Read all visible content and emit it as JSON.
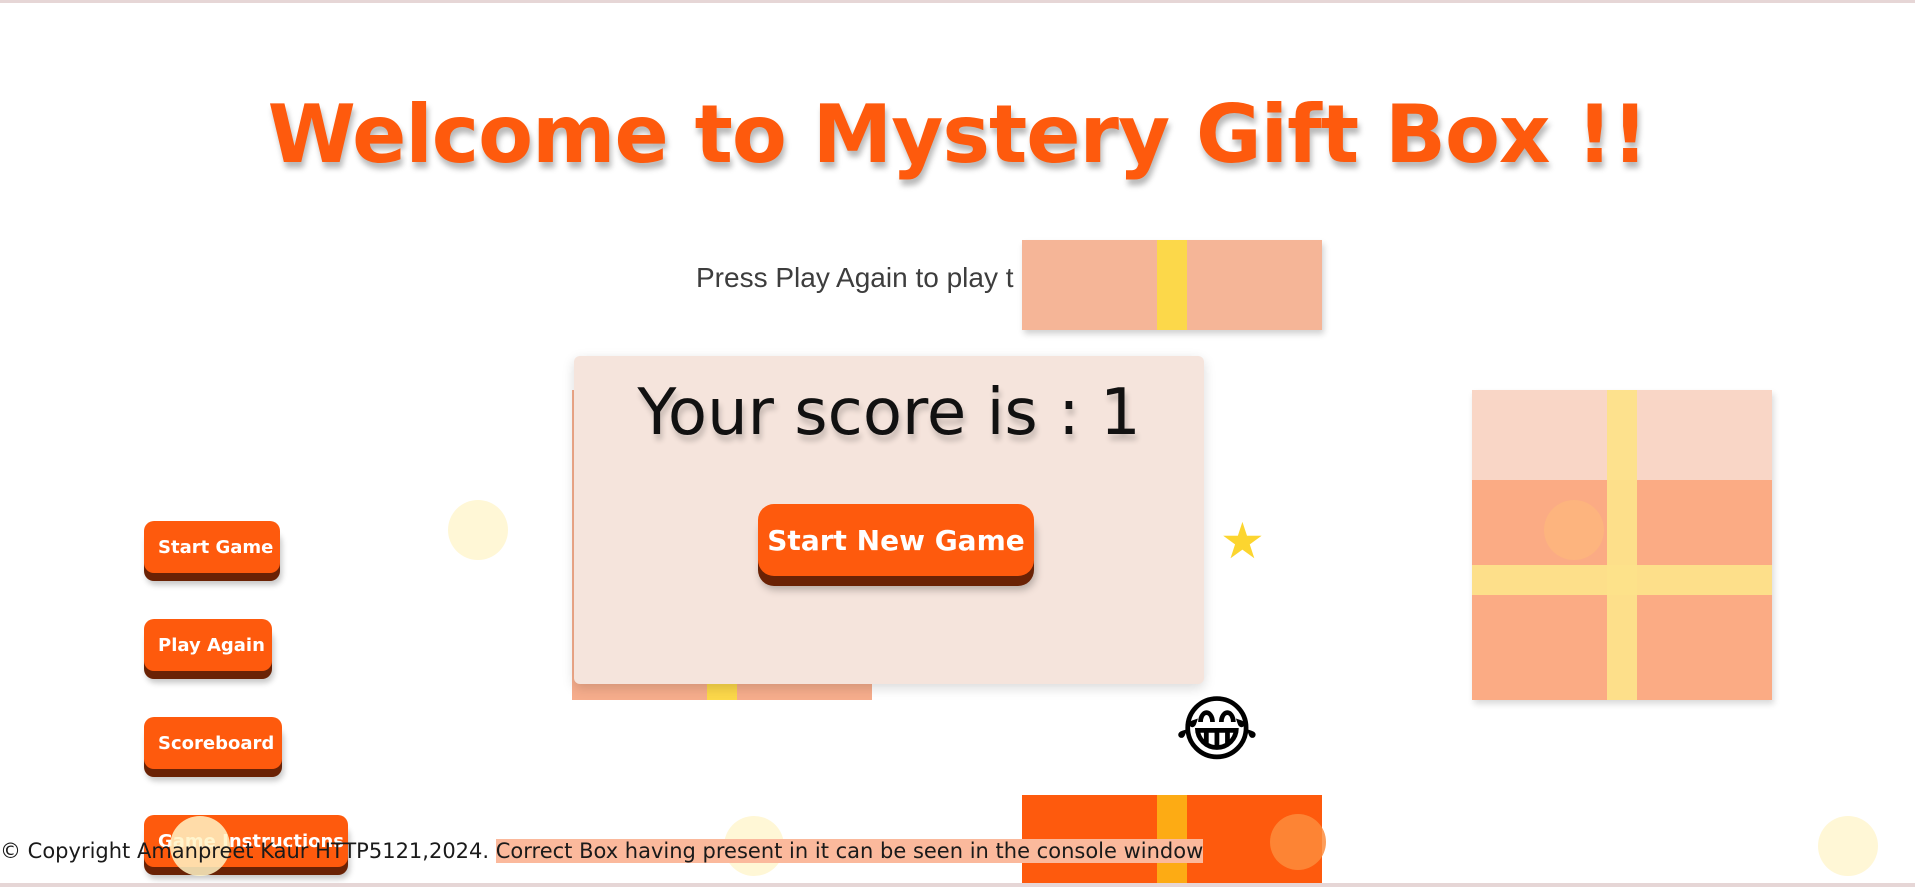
{
  "header": {
    "title": "Welcome to Mystery Gift Box !!",
    "hint": "Press Play Again to play t"
  },
  "modal": {
    "score_text": "Your score is : 1",
    "new_game_label": "Start New Game"
  },
  "side_menu": {
    "start_game": "Start Game",
    "play_again": "Play Again",
    "scoreboard": "Scoreboard",
    "game_instructions": "Game Instructions"
  },
  "decorations": {
    "star": "★",
    "emoji": "😂"
  },
  "footer": {
    "copyright": "© Copyright Amanpreet Kaur HTTP5121,2024. ",
    "console_note": "Correct Box having present in it can be seen in the console window"
  },
  "colors": {
    "accent": "#fe5a0d",
    "accent_dark": "#6a2205",
    "ribbon": "#fcd84a",
    "modal_bg": "#f5e4dc"
  }
}
